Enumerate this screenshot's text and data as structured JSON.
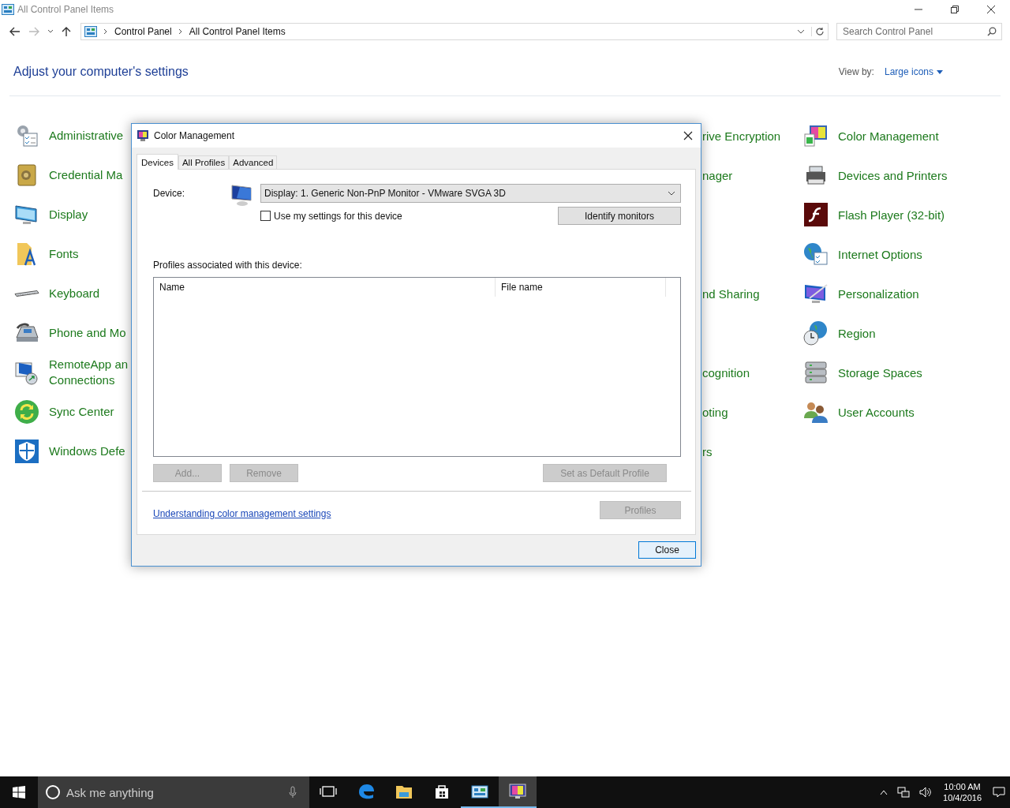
{
  "window": {
    "title": "All Control Panel Items"
  },
  "address_bar": {
    "breadcrumbs": [
      "Control Panel",
      "All Control Panel Items"
    ],
    "search_placeholder": "Search Control Panel"
  },
  "heading": "Adjust your computer's settings",
  "view_by": {
    "label": "View by:",
    "value": "Large icons"
  },
  "rows": [
    {
      "left": {
        "lines": [
          "Administrative"
        ]
      },
      "behind": "rive Encryption",
      "right": {
        "label": "Color Management"
      }
    },
    {
      "left": {
        "lines": [
          "Credential Ma"
        ]
      },
      "behind": "nager",
      "right": {
        "label": "Devices and Printers"
      }
    },
    {
      "left": {
        "lines": [
          "Display"
        ]
      },
      "right": {
        "label": "Flash Player (32-bit)"
      }
    },
    {
      "left": {
        "lines": [
          "Fonts"
        ]
      },
      "right": {
        "label": "Internet Options"
      }
    },
    {
      "left": {
        "lines": [
          "Keyboard"
        ]
      },
      "behind": "nd Sharing",
      "right": {
        "label": "Personalization"
      }
    },
    {
      "left": {
        "lines": [
          "Phone and Mo"
        ]
      },
      "right": {
        "label": "Region"
      }
    },
    {
      "left": {
        "lines": [
          "RemoteApp an",
          "Connections"
        ]
      },
      "behind": "cognition",
      "right": {
        "label": "Storage Spaces"
      }
    },
    {
      "left": {
        "lines": [
          "Sync Center"
        ]
      },
      "behind": "oting",
      "right": {
        "label": "User Accounts"
      }
    },
    {
      "left": {
        "lines": [
          "Windows Defe"
        ]
      },
      "behind": "rs"
    }
  ],
  "dialog": {
    "title": "Color Management",
    "tabs": [
      {
        "label": "Devices",
        "selected": true
      },
      {
        "label": "All Profiles",
        "selected": false
      },
      {
        "label": "Advanced",
        "selected": false
      }
    ],
    "device_label": "Device:",
    "device_value": "Display: 1. Generic Non-PnP Monitor - VMware SVGA 3D",
    "use_my_settings": {
      "label": "Use my settings for this device",
      "checked": false
    },
    "identify_button": {
      "label": "Identify monitors"
    },
    "profiles_label": "Profiles associated with this device:",
    "profile_columns": [
      "Name",
      "File name"
    ],
    "profile_buttons": [
      {
        "label": "Add...",
        "disabled": true
      },
      {
        "label": "Remove",
        "disabled": true
      },
      {
        "label": "Set as Default Profile",
        "disabled": true
      }
    ],
    "help_link": "Understanding color management settings",
    "profiles_button": {
      "label": "Profiles",
      "disabled": true
    },
    "close_button": {
      "label": "Close"
    }
  },
  "taskbar": {
    "search_placeholder": "Ask me anything",
    "apps": [
      {
        "kind": "taskview",
        "running": false,
        "selected": false
      },
      {
        "kind": "edge",
        "running": false,
        "selected": false
      },
      {
        "kind": "explorer",
        "running": false,
        "selected": false
      },
      {
        "kind": "store",
        "running": false,
        "selected": false
      },
      {
        "kind": "controlpanel",
        "running": true,
        "selected": false
      },
      {
        "kind": "colormgmt",
        "running": true,
        "selected": true
      }
    ],
    "time": "10:00 AM",
    "date": "10/4/2016"
  }
}
